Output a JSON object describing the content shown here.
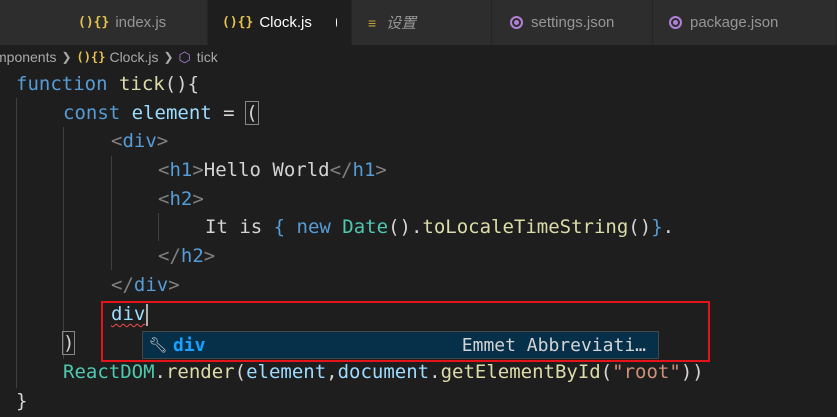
{
  "tabs": [
    {
      "icon": "js-icon",
      "glyph": "(){}",
      "label": "index.js"
    },
    {
      "icon": "js-icon",
      "glyph": "(){}",
      "label": "Clock.js",
      "active": true,
      "dirty": true
    },
    {
      "icon": "menu-icon",
      "label": "设置"
    },
    {
      "icon": "json-icon",
      "label": "settings.json"
    },
    {
      "icon": "json-icon",
      "label": "package.json"
    }
  ],
  "breadcrumb": {
    "folder": "mponents",
    "file": "Clock.js",
    "symbol": "tick"
  },
  "code": {
    "l1_kw": "function",
    "l1_fn": "tick",
    "l1_rest": "(){",
    "l2_kw": "const",
    "l2_var": "element",
    "l2_op": " = ",
    "l2_paren": "(",
    "l3_tag": "div",
    "l4_tag_open": "h1",
    "l4_text": "Hello World",
    "l4_tag_close": "h1",
    "l5_tag": "h2",
    "l6_text1": "It is ",
    "l6_brace_open": "{",
    "l6_kw": " new ",
    "l6_cls": "Date",
    "l6_call": "().",
    "l6_fn": "toLocaleTimeString",
    "l6_call2": "()",
    "l6_brace_close": "}",
    "l6_text2": ".",
    "l7_tag": "h2",
    "l8_tag": "div",
    "l9_typed": "div",
    "l10_paren": ")",
    "l11_cls": "ReactDOM",
    "l11_dot1": ".",
    "l11_fn": "render",
    "l11_open": "(",
    "l11_var1": "element",
    "l11_comma": ",",
    "l11_var2": "document",
    "l11_dot2": ".",
    "l11_fn2": "getElementById",
    "l11_open2": "(",
    "l11_str": "\"root\"",
    "l11_close": "))",
    "l12_brace": "}"
  },
  "suggest": {
    "icon": "wrench-icon",
    "label": "div",
    "detail": "Emmet Abbreviati…"
  },
  "colors": {
    "highlight_border": "#e5141b",
    "suggest_selected_bg": "#062f4a"
  }
}
